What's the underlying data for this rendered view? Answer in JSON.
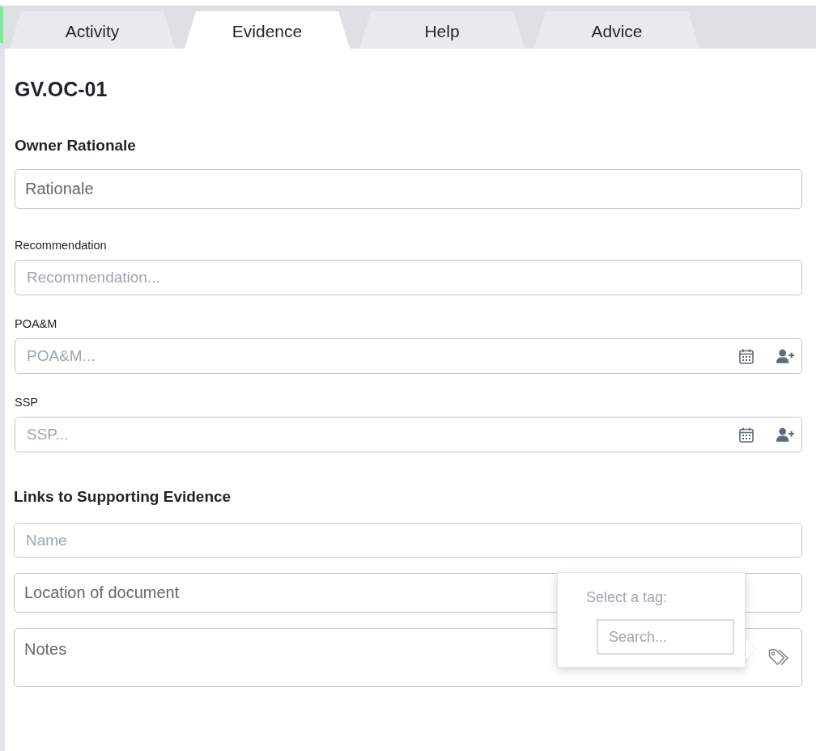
{
  "tabs": [
    {
      "label": "Activity",
      "selected": false
    },
    {
      "label": "Evidence",
      "selected": true
    },
    {
      "label": "Help",
      "selected": false
    },
    {
      "label": "Advice",
      "selected": false
    }
  ],
  "title": "GV.OC-01",
  "owner_rationale": {
    "heading": "Owner Rationale",
    "field": {
      "placeholder": "Rationale",
      "emphasized": true
    }
  },
  "fields": [
    {
      "label": "Recommendation",
      "placeholder": "Recommendation...",
      "emphasized": false,
      "kind": "plain"
    },
    {
      "label": "POA&M",
      "placeholder": "POA&M...",
      "emphasized": false,
      "kind": "actions"
    },
    {
      "label": "SSP",
      "placeholder": "SSP...",
      "emphasized": false,
      "kind": "actions"
    }
  ],
  "evidence": {
    "heading": "Links to Supporting Evidence",
    "fields": [
      {
        "kind": "input",
        "placeholder": "Name",
        "emphasized": false
      },
      {
        "kind": "input",
        "placeholder": "Location of document",
        "emphasized": true
      },
      {
        "kind": "notes",
        "placeholder": "Notes",
        "emphasized": true
      }
    ]
  },
  "tag_popover": {
    "title": "Select a tag:",
    "search_placeholder": "Search..."
  }
}
